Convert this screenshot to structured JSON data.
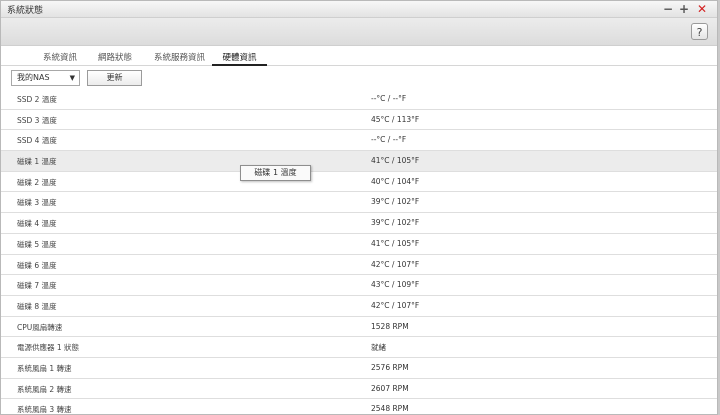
{
  "window": {
    "title": "系統狀態",
    "controls": {
      "minimize": "−",
      "maximize": "+",
      "close": "✕"
    },
    "help_label": "?"
  },
  "tabs": [
    {
      "label": "系統資訊",
      "active": false
    },
    {
      "label": "網路狀態",
      "active": false
    },
    {
      "label": "系統服務資訊",
      "active": false
    },
    {
      "label": "硬體資訊",
      "active": true
    }
  ],
  "toolbar": {
    "device_select": {
      "value": "我的NAS",
      "arrow": "▼"
    },
    "refresh_label": "更新"
  },
  "rows": [
    {
      "label": "SSD 2 溫度",
      "value": "--°C / --°F"
    },
    {
      "label": "SSD 3 溫度",
      "value": "45°C / 113°F"
    },
    {
      "label": "SSD 4 溫度",
      "value": "--°C / --°F"
    },
    {
      "label": "磁碟 1 溫度",
      "value": "41°C / 105°F"
    },
    {
      "label": "磁碟 2 溫度",
      "value": "40°C / 104°F"
    },
    {
      "label": "磁碟 3 溫度",
      "value": "39°C / 102°F"
    },
    {
      "label": "磁碟 4 溫度",
      "value": "39°C / 102°F"
    },
    {
      "label": "磁碟 5 溫度",
      "value": "41°C / 105°F"
    },
    {
      "label": "磁碟 6 溫度",
      "value": "42°C / 107°F"
    },
    {
      "label": "磁碟 7 溫度",
      "value": "43°C / 109°F"
    },
    {
      "label": "磁碟 8 溫度",
      "value": "42°C / 107°F"
    },
    {
      "label": "CPU風扇轉速",
      "value": "1528 RPM"
    },
    {
      "label": "電源供應器 1 狀態",
      "value": "就緒"
    },
    {
      "label": "系統風扇 1 轉速",
      "value": "2576 RPM"
    },
    {
      "label": "系統風扇 2 轉速",
      "value": "2607 RPM"
    },
    {
      "label": "系統風扇 3 轉速",
      "value": "2548 RPM"
    }
  ],
  "tooltip": {
    "text": "磁碟 1 溫度"
  }
}
